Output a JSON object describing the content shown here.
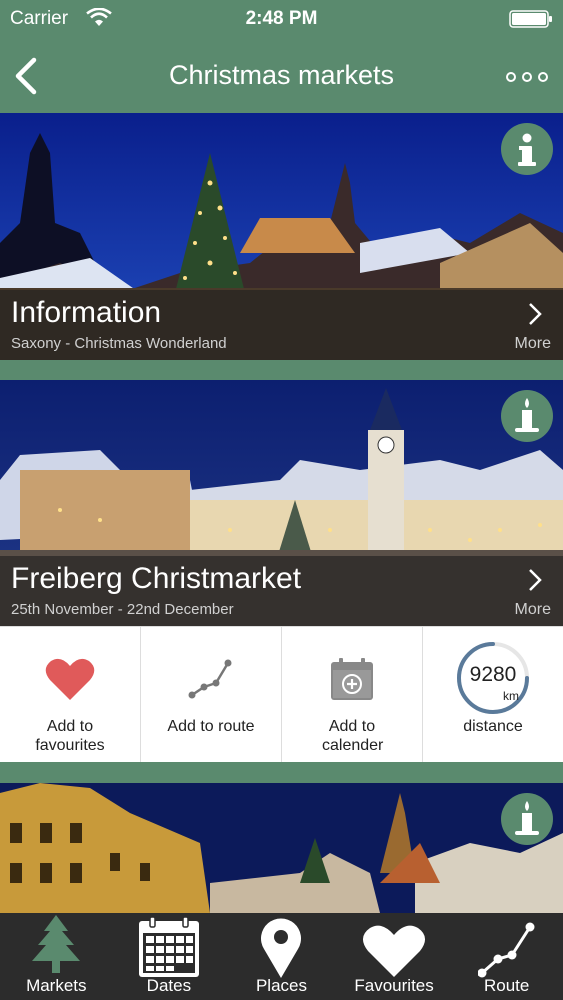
{
  "status": {
    "carrier": "Carrier",
    "time": "2:48 PM"
  },
  "nav": {
    "title": "Christmas markets"
  },
  "cards": [
    {
      "title": "Information",
      "subtitle": "Saxony - Christmas Wonderland",
      "more": "More",
      "badge_icon": "info-icon"
    },
    {
      "title": "Freiberg Christmarket",
      "subtitle": "25th November - 22nd December",
      "more": "More",
      "badge_icon": "candle-icon"
    },
    {
      "badge_icon": "candle-icon"
    }
  ],
  "actions": [
    {
      "label": "Add to favourites",
      "icon": "heart-icon"
    },
    {
      "label": "Add to route",
      "icon": "route-icon"
    },
    {
      "label": "Add to calender",
      "icon": "calendar-add-icon"
    },
    {
      "label": "distance",
      "value": "9280",
      "unit": "km",
      "icon": "distance-gauge"
    }
  ],
  "tabs": [
    {
      "label": "Markets",
      "icon": "tree-icon"
    },
    {
      "label": "Dates",
      "icon": "calendar-icon"
    },
    {
      "label": "Places",
      "icon": "pin-icon"
    },
    {
      "label": "Favourites",
      "icon": "heart-icon"
    },
    {
      "label": "Route",
      "icon": "route-icon"
    }
  ],
  "colors": {
    "brand_green": "#5a8a6e",
    "tab_bar": "#2c2c2c",
    "heart_red": "#e05a5a",
    "overlay": "#1e1e1e"
  }
}
